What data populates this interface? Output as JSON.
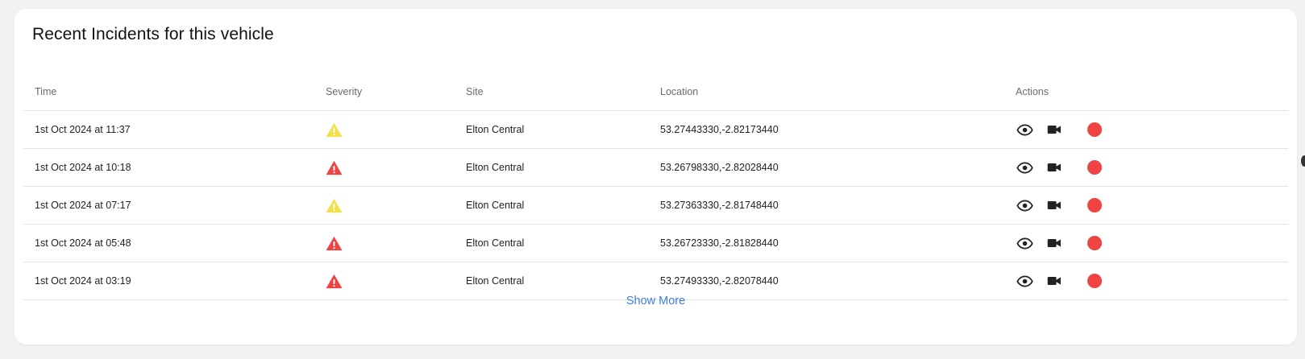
{
  "card": {
    "title": "Recent Incidents for this vehicle",
    "show_more_label": "Show More"
  },
  "table": {
    "columns": [
      "Time",
      "Severity",
      "Site",
      "Location",
      "Actions"
    ],
    "rows": [
      {
        "time": "1st Oct 2024 at 11:37",
        "severity": "warning",
        "site": "Elton Central",
        "location": "53.27443330,-2.82173440"
      },
      {
        "time": "1st Oct 2024 at 10:18",
        "severity": "critical",
        "site": "Elton Central",
        "location": "53.26798330,-2.82028440"
      },
      {
        "time": "1st Oct 2024 at 07:17",
        "severity": "warning",
        "site": "Elton Central",
        "location": "53.27363330,-2.81748440"
      },
      {
        "time": "1st Oct 2024 at 05:48",
        "severity": "critical",
        "site": "Elton Central",
        "location": "53.26723330,-2.81828440"
      },
      {
        "time": "1st Oct 2024 at 03:19",
        "severity": "critical",
        "site": "Elton Central",
        "location": "53.27493330,-2.82078440"
      }
    ]
  },
  "icons": {
    "view": "eye-icon",
    "video": "video-camera-icon",
    "record": "record-dot-icon",
    "severity_warning": "warning-triangle-icon",
    "severity_critical": "alert-triangle-icon"
  },
  "colors": {
    "warning": "#f2e24a",
    "critical": "#ee4444",
    "link": "#3d7fde",
    "record": "#ee4444"
  }
}
